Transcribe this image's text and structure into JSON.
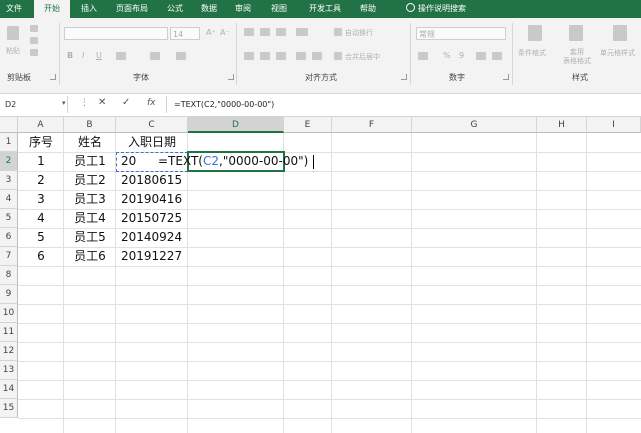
{
  "tabs": [
    "文件",
    "开始",
    "插入",
    "页面布局",
    "公式",
    "数据",
    "审阅",
    "视图",
    "开发工具",
    "帮助",
    "操作说明搜索"
  ],
  "active_tab": "开始",
  "ribbon": {
    "paste_label": "粘贴",
    "clipboard_label": "剪贴板",
    "font_label": "字体",
    "font_size": "14",
    "font_buttons": [
      "B",
      "I",
      "U"
    ],
    "alignment_label": "对齐方式",
    "wrap_text": "自动换行",
    "merge_center": "合并后居中",
    "number_label": "数字",
    "number_format": "常规",
    "percent": "%",
    "comma": "9",
    "styles_label": "样式",
    "conditional_format": "条件格式",
    "table_format": "套用\n表格格式",
    "cell_styles": "单元格样式"
  },
  "formula_bar": {
    "name_box": "D2",
    "fx": "fx",
    "formula": "=TEXT(C2,\"0000-00-00\")"
  },
  "sheet": {
    "columns": [
      "A",
      "B",
      "C",
      "D",
      "E",
      "F",
      "G",
      "H",
      "I"
    ],
    "selected_column": "D",
    "rows": [
      "1",
      "2",
      "3",
      "4",
      "5",
      "6",
      "7",
      "8",
      "9",
      "10",
      "11",
      "12",
      "13",
      "14",
      "15"
    ],
    "selected_row": "2",
    "header": [
      "序号",
      "姓名",
      "入职日期"
    ],
    "data": [
      [
        "1",
        "员工1",
        "20"
      ],
      [
        "2",
        "员工2",
        "20180615"
      ],
      [
        "3",
        "员工3",
        "20190416"
      ],
      [
        "4",
        "员工4",
        "20150725"
      ],
      [
        "5",
        "员工5",
        "20140924"
      ],
      [
        "6",
        "员工6",
        "20191227"
      ]
    ],
    "edit_cell": {
      "prefix": "=TEXT(",
      "ref": "C2",
      "suffix": ",\"0000-00-00\")"
    }
  },
  "colors": {
    "excel_green": "#217346",
    "ref_blue": "#3b6fd4"
  }
}
